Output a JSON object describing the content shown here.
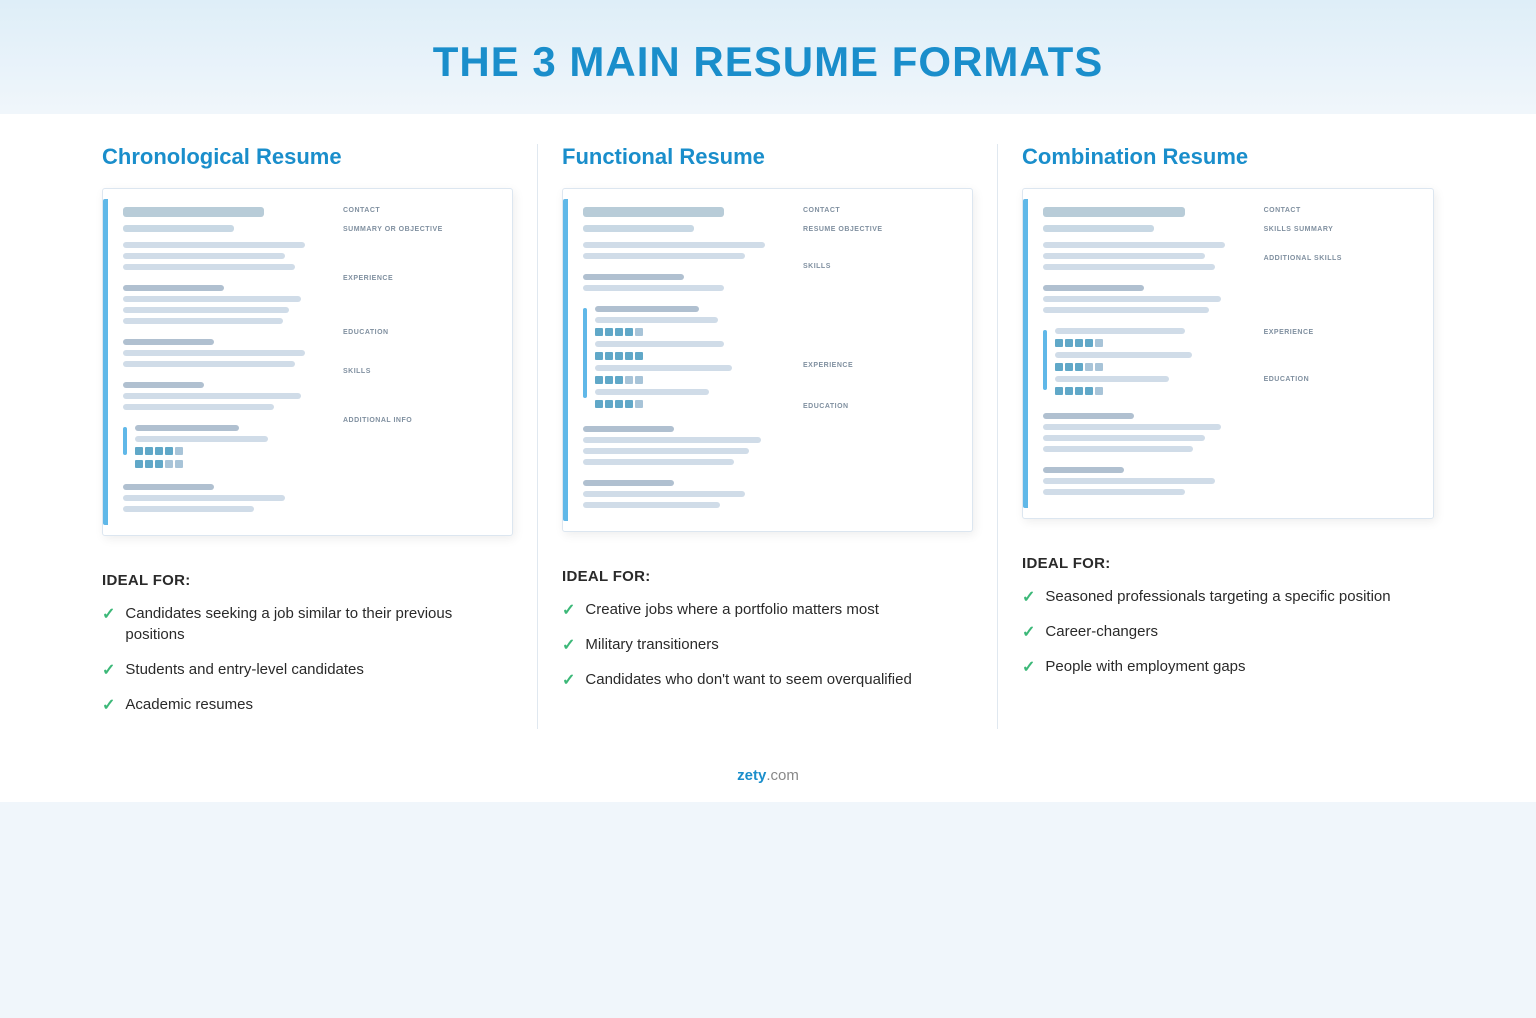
{
  "page": {
    "title": "THE 3 MAIN RESUME FORMATS",
    "background_color": "#f0f6fb"
  },
  "columns": [
    {
      "id": "chronological",
      "title": "Chronological Resume",
      "resume_labels": [
        "CONTACT",
        "SUMMARY OR OBJECTIVE",
        "EXPERIENCE",
        "EDUCATION",
        "SKILLS",
        "ADDITIONAL INFO"
      ],
      "ideal_for_title": "IDEAL FOR:",
      "ideal_items": [
        "Candidates seeking a job similar to their previous positions",
        "Students and entry-level candidates",
        "Academic resumes"
      ]
    },
    {
      "id": "functional",
      "title": "Functional Resume",
      "resume_labels": [
        "CONTACT",
        "RESUME OBJECTIVE",
        "SKILLS",
        "EXPERIENCE",
        "EDUCATION"
      ],
      "ideal_for_title": "IDEAL FOR:",
      "ideal_items": [
        "Creative jobs where a portfolio matters most",
        "Military transitioners",
        "Candidates who don't want to seem overqualified"
      ]
    },
    {
      "id": "combination",
      "title": "Combination Resume",
      "resume_labels": [
        "CONTACT",
        "SKILLS SUMMARY",
        "ADDITIONAL SKILLS",
        "EXPERIENCE",
        "EDUCATION"
      ],
      "ideal_for_title": "IDEAL FOR:",
      "ideal_items": [
        "Seasoned professionals targeting a specific position",
        "Career-changers",
        "People with employment gaps"
      ]
    }
  ],
  "footer": {
    "brand": "zety",
    "domain": ".com"
  },
  "check_symbol": "✓"
}
